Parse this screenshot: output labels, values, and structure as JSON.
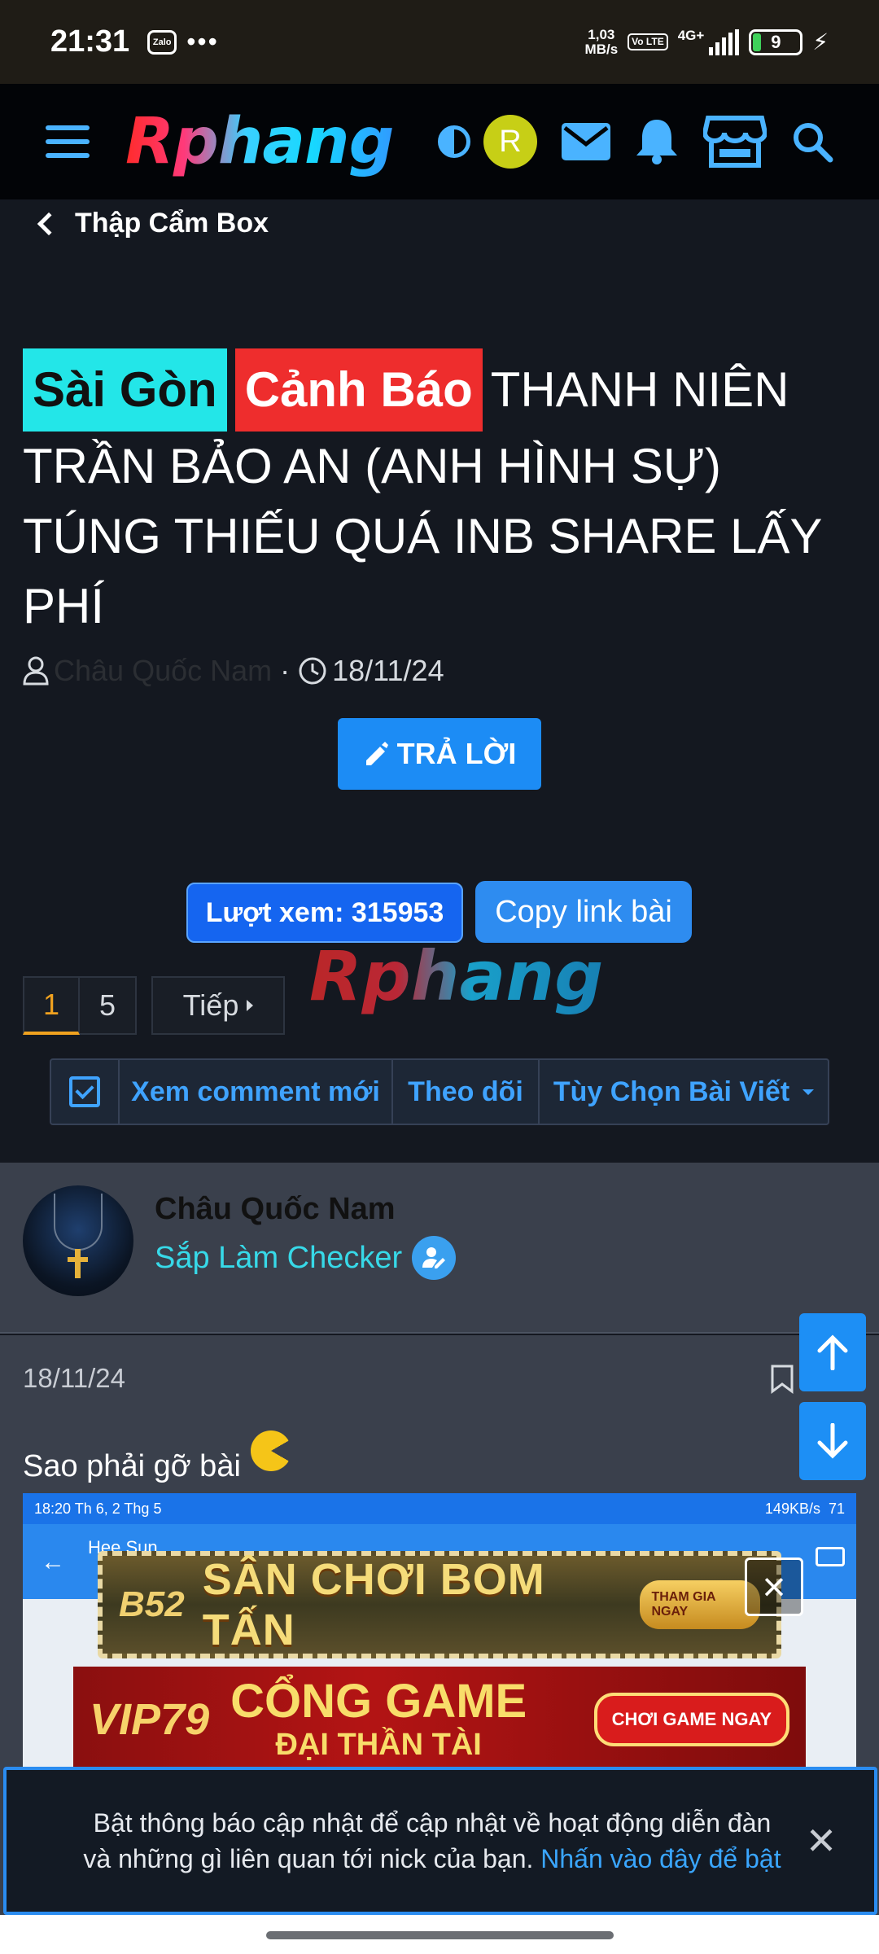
{
  "status_bar": {
    "time": "21:31",
    "zalo": "Zalo",
    "dots": "•••",
    "speed_value": "1,03",
    "speed_unit": "MB/s",
    "volte": "Vo LTE",
    "network": "4G+",
    "battery": "9"
  },
  "header": {
    "logo": "Rphang",
    "avatar_letter": "R"
  },
  "breadcrumb": {
    "label": "Thập Cẩm Box"
  },
  "thread": {
    "prefix_1": "Sài Gòn",
    "prefix_2": "Cảnh Báo",
    "title": "THANH NIÊN TRẦN BẢO AN (ANH HÌNH SỰ) TÚNG THIẾU QUÁ INB SHARE LẤY PHÍ",
    "author": "Châu Quốc Nam",
    "separator": "·",
    "date": "18/11/24",
    "reply_label": "TRẢ LỜI",
    "views_label": "Lượt xem: 315953",
    "copy_label": "Copy link bài",
    "watermark": "Rphang"
  },
  "pagination": {
    "page_current": "1",
    "page_last": "5",
    "next_label": "Tiếp"
  },
  "actions": {
    "new_comments": "Xem comment mới",
    "follow": "Theo dõi",
    "options": "Tùy Chọn Bài Viết"
  },
  "post": {
    "author_name": "Châu Quốc Nam",
    "author_role": "Sắp Làm Checker",
    "date": "18/11/24",
    "text": "Sao phải gỡ bài"
  },
  "embedded_screenshot": {
    "status_left": "18:20 Th 6, 2 Thg 5",
    "status_right": "149KB/s",
    "battery": "71",
    "contact_name": "Hee Sun"
  },
  "ads": {
    "ad1_brand": "B52",
    "ad1_main": "SÂN CHƠI BOM TẤN",
    "ad1_cta": "THAM GIA NGAY",
    "ad2_brand": "VIP79",
    "ad2_line1": "CỔNG GAME",
    "ad2_line2": "ĐẠI THẦN TÀI",
    "ad2_cta": "CHƠI GAME NGAY"
  },
  "notification": {
    "text": "Bật thông báo cập nhật để cập nhật về hoạt động diễn đàn và những gì liên quan tới nick của bạn.",
    "link": "Nhấn vào đây để bật"
  },
  "colors": {
    "accent_blue": "#1c8cf5",
    "prefix_saigon": "#23e6e8",
    "prefix_canhbao": "#ee2d2d",
    "page_active": "#f0a21f",
    "role_text": "#37d9e8"
  }
}
